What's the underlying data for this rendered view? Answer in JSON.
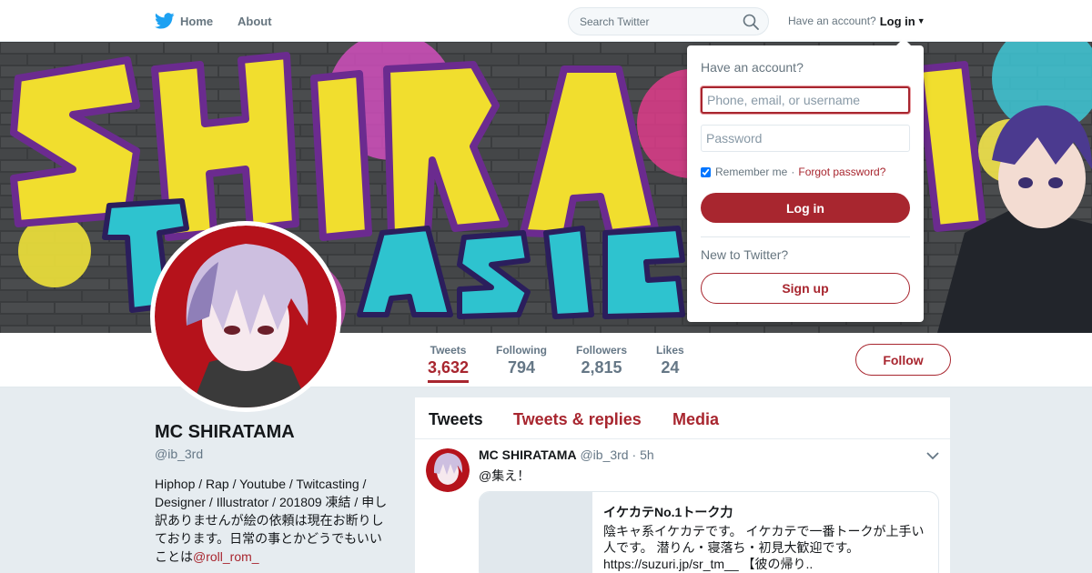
{
  "nav": {
    "home_label": "Home",
    "about_label": "About",
    "search_placeholder": "Search Twitter",
    "account_prompt": "Have an account?",
    "login_label": "Log in"
  },
  "login_dropdown": {
    "title": "Have an account?",
    "username_placeholder": "Phone, email, or username",
    "password_placeholder": "Password",
    "remember_label": "Remember me",
    "separator": "·",
    "forgot_label": "Forgot password?",
    "login_button": "Log in",
    "new_prompt": "New to Twitter?",
    "signup_button": "Sign up"
  },
  "profile": {
    "name": "MC SHIRATAMA",
    "handle": "@ib_3rd",
    "bio_text": "Hiphop / Rap / Youtube / Twitcasting / Designer / Illustrator / 201809 凍結 / 申し訳ありませんが絵の依頼は現在お断りしております。日常の事とかどうでもいいことは",
    "bio_mention": "@roll_rom_",
    "follow_label": "Follow"
  },
  "stats": [
    {
      "label": "Tweets",
      "value": "3,632",
      "active": true
    },
    {
      "label": "Following",
      "value": "794",
      "active": false
    },
    {
      "label": "Followers",
      "value": "2,815",
      "active": false
    },
    {
      "label": "Likes",
      "value": "24",
      "active": false
    }
  ],
  "timeline": {
    "tabs": [
      "Tweets",
      "Tweets & replies",
      "Media"
    ],
    "tweet": {
      "name": "MC SHIRATAMA",
      "handle": "@ib_3rd",
      "dot": "·",
      "time": "5h",
      "text": "@集え！",
      "card_title": "イケカテNo.1トーク力",
      "card_desc": "陰キャ系イケカテです。 イケカテで一番トークが上手い人です。 潜りん・寝落ち・初見大歓迎です。 https://suzuri.jp/sr_tm__ 【彼の帰り.."
    }
  },
  "colors": {
    "accent": "#a8262f",
    "text_muted": "#657786",
    "background": "#e6ecf0"
  },
  "icons": [
    "twitter-bird-icon",
    "search-icon",
    "caret-down-icon",
    "chevron-down-icon"
  ]
}
